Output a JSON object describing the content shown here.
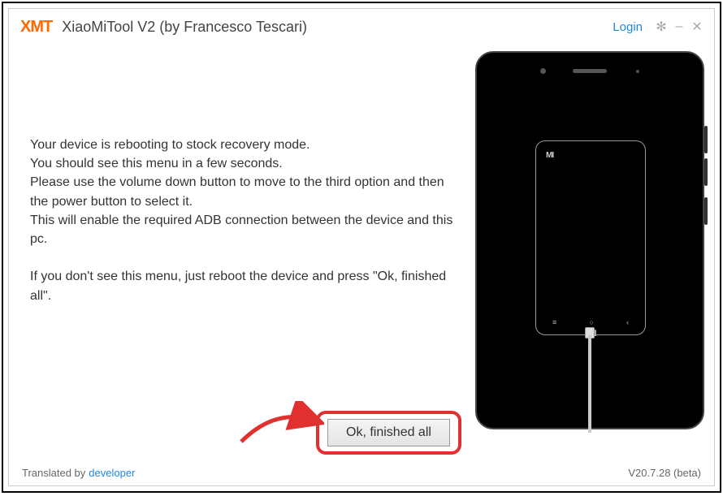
{
  "header": {
    "logo_text": "XMT",
    "title": "XiaoMiTool V2 (by Francesco Tescari)",
    "login_label": "Login"
  },
  "instructions": {
    "body": "Your device is rebooting to stock recovery mode.\nYou should see this menu in a few seconds.\nPlease use the volume down button to move to the third option and then the power button to select it.\nThis will enable the required ADB connection between the device and this pc.\n\nIf you don't see this menu, just reboot the device and press \"Ok, finished all\"."
  },
  "phone": {
    "brand_glyph": "MI"
  },
  "action": {
    "ok_label": "Ok, finished all"
  },
  "footer": {
    "translated_by": "Translated by",
    "developer": "developer",
    "version": "V20.7.28 (beta)"
  }
}
